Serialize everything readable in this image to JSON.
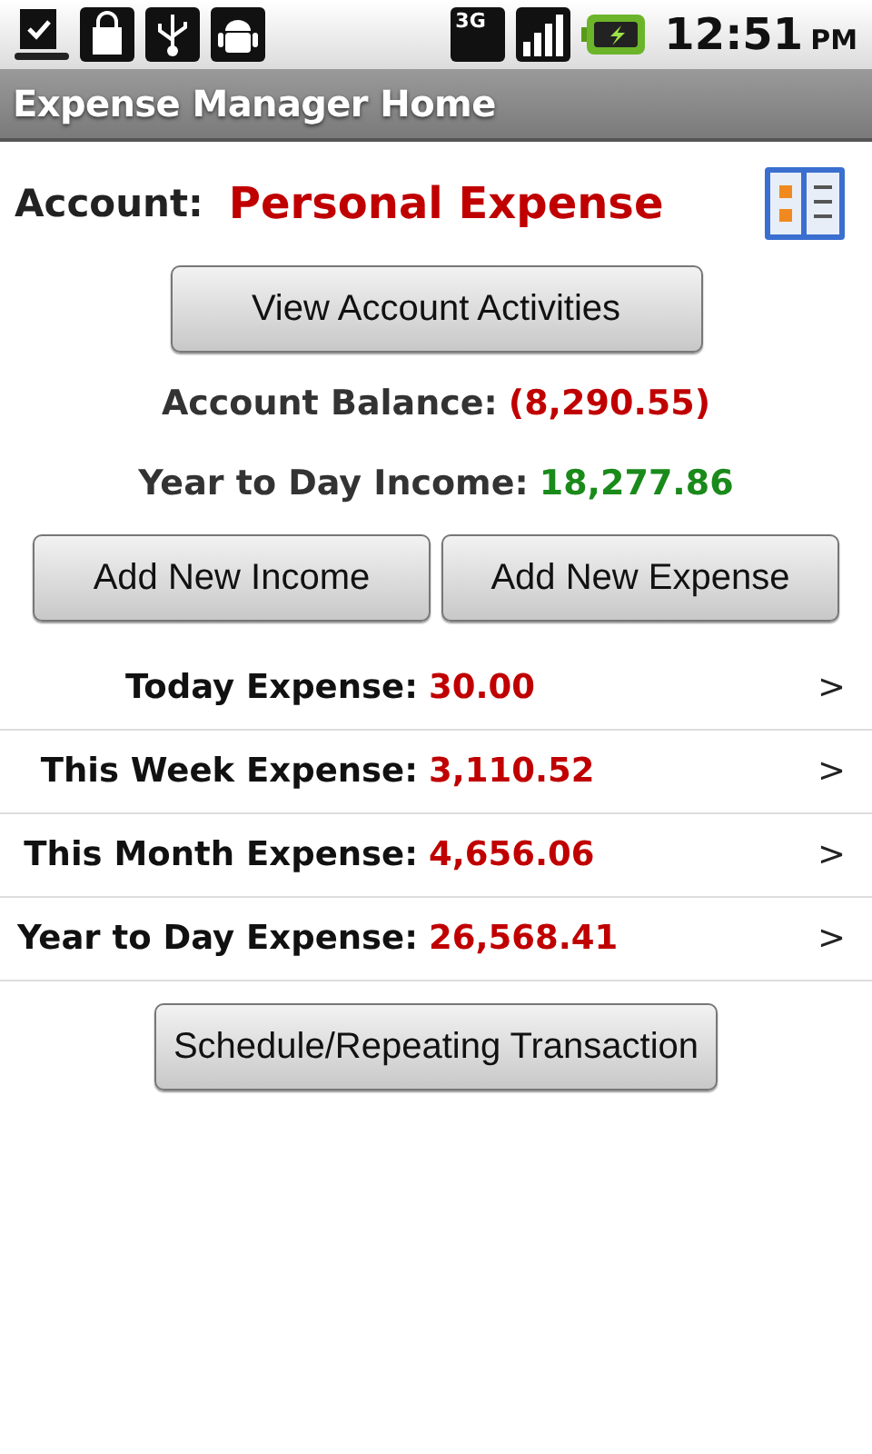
{
  "status_bar": {
    "network": "3G",
    "time": "12:51",
    "ampm": "PM"
  },
  "title_bar": {
    "title": "Expense Manager Home"
  },
  "account": {
    "label": "Account:",
    "name": "Personal Expense"
  },
  "view_button": "View Account Activities",
  "summary": [
    {
      "label": "Account Balance:",
      "value": "(8,290.55)",
      "color": "#c00000"
    },
    {
      "label": "Year to Day Income:",
      "value": "18,277.86",
      "color": "#1a8a1a"
    }
  ],
  "add_buttons": [
    "Add New Income",
    "Add New Expense"
  ],
  "expense_rows": [
    {
      "label": "Today Expense:",
      "value": "30.00",
      "arrow": ">"
    },
    {
      "label": "This Week Expense:",
      "value": "3,110.52",
      "arrow": ">"
    },
    {
      "label": "This Month Expense:",
      "value": "4,656.06",
      "arrow": ">"
    },
    {
      "label": "Year to Day Expense:",
      "value": "26,568.41",
      "arrow": ">"
    }
  ],
  "schedule_button": "Schedule/Repeating Transaction"
}
